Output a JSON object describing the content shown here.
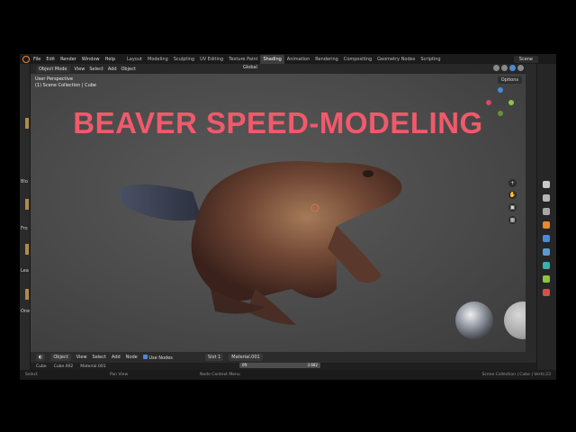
{
  "topbar": {
    "menu": [
      "File",
      "Edit",
      "Render",
      "Window",
      "Help"
    ],
    "workspaces": [
      "Layout",
      "Modeling",
      "Sculpting",
      "UV Editing",
      "Texture Paint",
      "Shading",
      "Animation",
      "Rendering",
      "Compositing",
      "Geometry Nodes",
      "Scripting"
    ],
    "active_workspace": "Shading",
    "scene": "Scene"
  },
  "leftstrip": {
    "labels": [
      "Blo",
      "Fro",
      "Lea",
      "One"
    ]
  },
  "viewport": {
    "mode": "Object Mode",
    "menus": [
      "View",
      "Select",
      "Add",
      "Object"
    ],
    "transform": "Global",
    "options": "Options",
    "perspective": "User Perspective",
    "collection": "(1) Scene Collection | Cube"
  },
  "title": "BEAVER SPEED-MODELING",
  "gizmo": {
    "x": "X",
    "y": "Y",
    "z": "Z"
  },
  "nodebar": {
    "type": "Object",
    "menus": [
      "View",
      "Select",
      "Add",
      "Node"
    ],
    "use_nodes": "Use Nodes",
    "slot": "Slot 1",
    "material": "Material.001"
  },
  "breadcrumb": [
    "Cube",
    "Cube.002",
    "Material.001"
  ],
  "ministrip": {
    "left": "0ft",
    "right": "3.682"
  },
  "status": {
    "select": "Select",
    "pan": "Pan View",
    "context": "Node Context Menu",
    "right": "Scene Collection | Cube | Verts:23"
  },
  "colors": {
    "title": "#f2596b",
    "accent": "#4a8ad6",
    "logo": "#e88a2d"
  }
}
